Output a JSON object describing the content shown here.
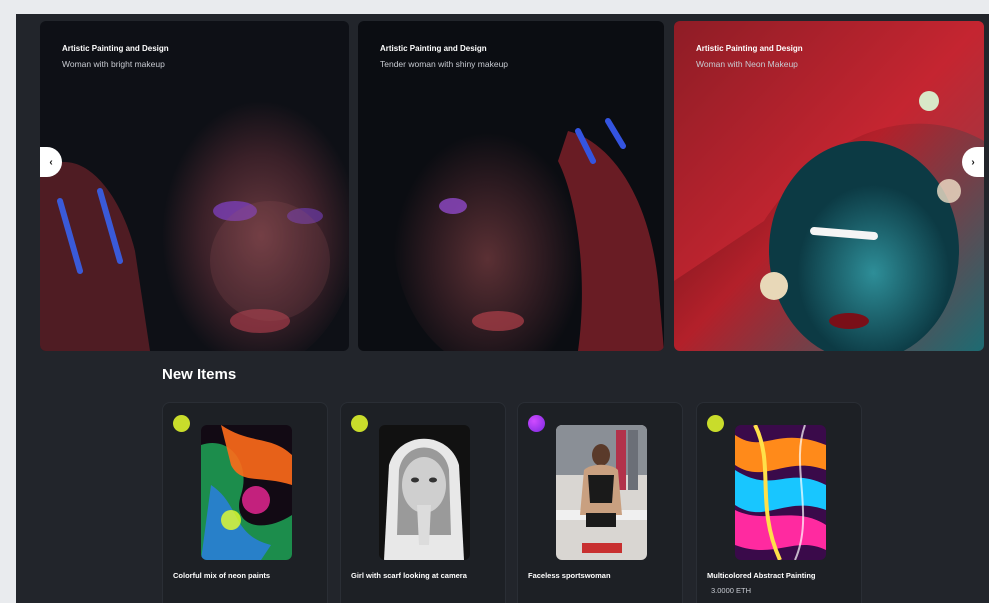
{
  "carousel": {
    "slides": [
      {
        "category": "Artistic Painting and Design",
        "title": "Woman with bright makeup"
      },
      {
        "category": "Artistic Painting and Design",
        "title": "Tender woman with shiny makeup"
      },
      {
        "category": "Artistic Painting and Design",
        "title": "Woman with Neon Makeup"
      }
    ],
    "prev_label": "‹",
    "next_label": "›"
  },
  "new_items": {
    "heading": "New Items",
    "items": [
      {
        "title": "Colorful mix of neon paints",
        "price": "",
        "avatar_color": "#c9dc2b"
      },
      {
        "title": "Girl with scarf looking at camera",
        "price": "",
        "avatar_color": "#c9dc2b"
      },
      {
        "title": "Faceless sportswoman",
        "price": "",
        "avatar_color": "#b13bff"
      },
      {
        "title": "Multicolored Abstract Painting",
        "price": "3.0000 ETH",
        "avatar_color": "#c9dc2b"
      }
    ]
  },
  "icons": {
    "prev": "chevron-left-icon",
    "next": "chevron-right-icon"
  }
}
